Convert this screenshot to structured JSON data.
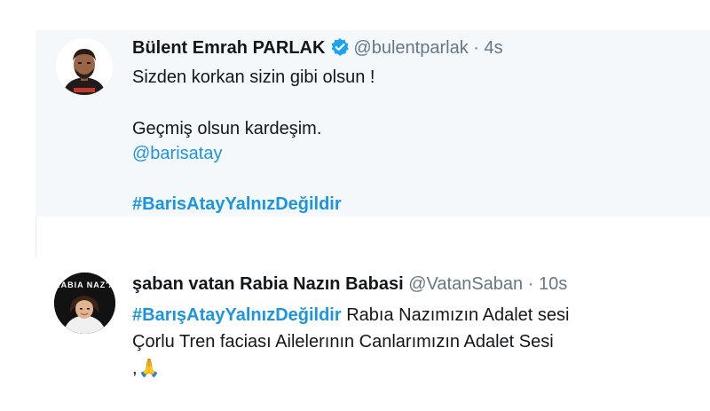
{
  "tweets": [
    {
      "display_name": "Bülent Emrah PARLAK",
      "handle": "@bulentparlak",
      "separator": "·",
      "time": "4s",
      "verified": true,
      "lines": {
        "line1": "Sizden korkan sizin gibi olsun !",
        "line2": "Geçmiş olsun kardeşim.",
        "mention": "@barisatay",
        "hashtag": "#BarisAtayYalnızDeğildir"
      },
      "avatar_icon": "profile-photo-man-icon"
    },
    {
      "display_name": "şaban vatan Rabia Nazın Babasi",
      "handle": "@VatanSaban",
      "separator": "·",
      "time": "10s",
      "verified": false,
      "lines": {
        "hashtag": "#BarışAtayYalnızDeğildir",
        "line1_rest": " Rabıa Nazımızın Adalet sesi",
        "line2": "Çorlu Tren faciası Ailelerının Canlarımızın Adalet Sesi",
        "line3_prefix": ",",
        "emoji": "🙏"
      },
      "avatar_text": "RABIA NAZ'A",
      "avatar_icon": "profile-photo-girl-icon"
    }
  ],
  "colors": {
    "link": "#1b95e0",
    "text": "#14171a",
    "muted": "#657786",
    "highlight_bg": "#f5f8fa",
    "verified": "#1da1f2"
  }
}
